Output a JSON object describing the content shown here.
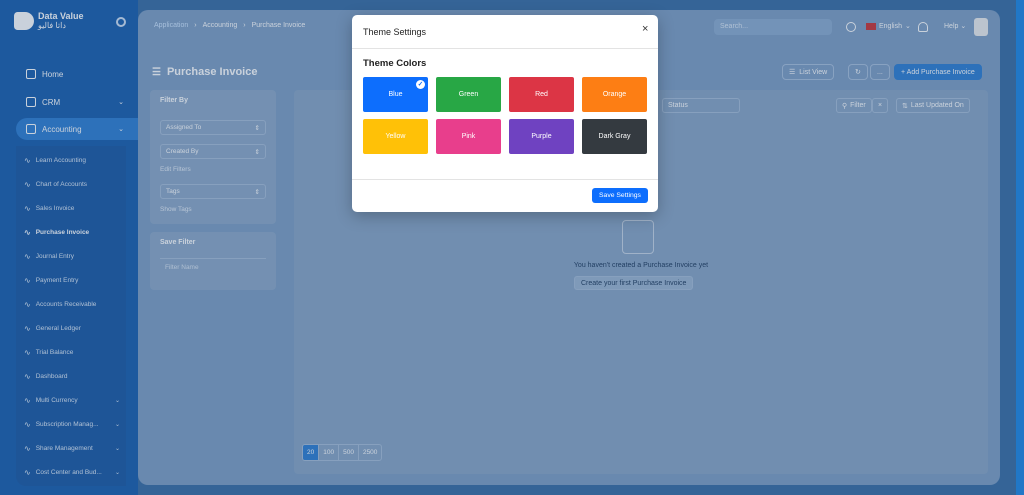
{
  "sidebar": {
    "brand": "Data Value",
    "brand_sub": "داتا فاليو",
    "top_items": [
      {
        "label": "Home"
      },
      {
        "label": "CRM"
      },
      {
        "label": "Accounting"
      }
    ],
    "sub_items": [
      {
        "label": "Learn Accounting"
      },
      {
        "label": "Chart of Accounts"
      },
      {
        "label": "Sales Invoice"
      },
      {
        "label": "Purchase Invoice"
      },
      {
        "label": "Journal Entry"
      },
      {
        "label": "Payment Entry"
      },
      {
        "label": "Accounts Receivable"
      },
      {
        "label": "General Ledger"
      },
      {
        "label": "Trial Balance"
      },
      {
        "label": "Dashboard"
      },
      {
        "label": "Multi Currency"
      },
      {
        "label": "Subscription Manag..."
      },
      {
        "label": "Share Management"
      },
      {
        "label": "Cost Center and Bud..."
      }
    ]
  },
  "topbar": {
    "breadcrumb": [
      "Application",
      "Accounting",
      "Purchase Invoice"
    ],
    "search_placeholder": "Search...",
    "language": "English",
    "help": "Help"
  },
  "page": {
    "title": "Purchase Invoice",
    "list_view": "List View",
    "more": "...",
    "add_label": "+ Add Purchase Invoice"
  },
  "filters": {
    "heading": "Filter By",
    "assigned_to": "Assigned To",
    "created_by": "Created By",
    "edit_filters": "Edit Filters",
    "tags": "Tags",
    "show_tags": "Show Tags",
    "save_heading": "Save Filter",
    "filter_name_placeholder": "Filter Name"
  },
  "list": {
    "status_placeholder": "Status",
    "filter_label": "Filter",
    "sort_label": "Last Updated On",
    "empty_message": "You haven't created a Purchase Invoice yet",
    "create_label": "Create your first Purchase Invoice",
    "page_sizes": [
      "20",
      "100",
      "500",
      "2500"
    ]
  },
  "modal": {
    "title": "Theme Settings",
    "close": "×",
    "section": "Theme Colors",
    "selected": "Blue",
    "save_label": "Save Settings",
    "themes": [
      {
        "name": "Blue",
        "color": "#0d6efd"
      },
      {
        "name": "Green",
        "color": "#28a745"
      },
      {
        "name": "Red",
        "color": "#dc3545"
      },
      {
        "name": "Orange",
        "color": "#fd7e14"
      },
      {
        "name": "Yellow",
        "color": "#ffc107"
      },
      {
        "name": "Pink",
        "color": "#e83e8c"
      },
      {
        "name": "Purple",
        "color": "#6f42c1"
      },
      {
        "name": "Dark Gray",
        "color": "#343a40"
      }
    ]
  }
}
